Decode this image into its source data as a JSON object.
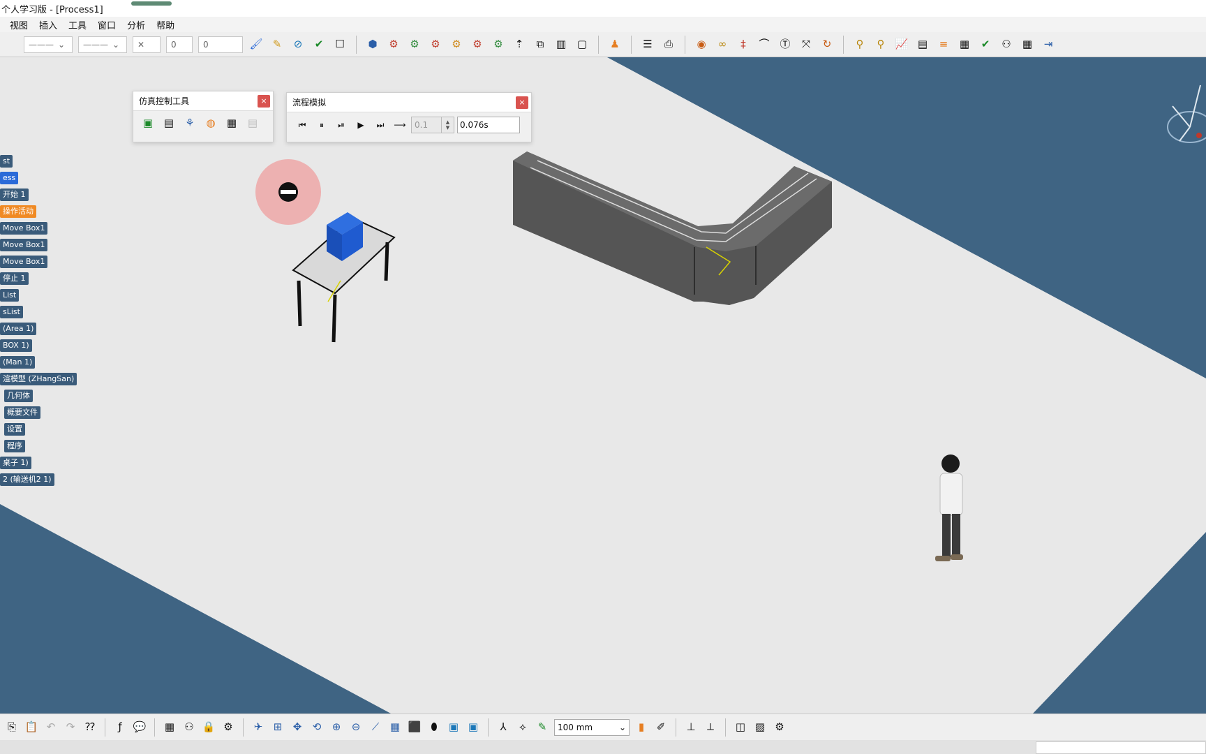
{
  "window": {
    "title": "个人学习版  - [Process1]"
  },
  "menu": {
    "items": [
      "视图",
      "插入",
      "工具",
      "窗口",
      "分析",
      "帮助"
    ]
  },
  "top_toolbar": {
    "line_combo_1": "———",
    "line_combo_2": "———",
    "weight_combo": "✕",
    "layer_combo": "0",
    "value_field": "0"
  },
  "sim_control_panel": {
    "title": "仿真控制工具",
    "close": "×"
  },
  "process_sim_panel": {
    "title": "流程模拟",
    "close": "×",
    "step_value": "0.1",
    "time_value": "0.076s"
  },
  "tree": {
    "items": [
      "st",
      "ess",
      "开始 1",
      "操作活动",
      "Move Box1",
      "Move Box1",
      "Move Box1",
      "停止 1",
      "List",
      "sList",
      "(Area 1)",
      "BOX 1)",
      "(Man 1)",
      "渲模型 (ZHangSan)",
      "几何体",
      "概要文件",
      "设置",
      "程序",
      "桌子 1)",
      "2 (输送机2 1)"
    ]
  },
  "bottom_toolbar": {
    "zoom_value": "100 mm"
  },
  "colors": {
    "floor": "#e8e8e8",
    "background_blue": "#3f6483",
    "tree_node": "#3a5b7a",
    "tree_highlight": "#f08a24",
    "box_blue": "#1f5bd0",
    "conveyor": "#555555"
  },
  "icons": {
    "top": [
      "brush-icon",
      "pen-icon",
      "compass-icon",
      "check-icon",
      "checkbox-icon",
      "catalog-icon",
      "robot-icon",
      "gear-icon",
      "gear-icon",
      "gear-icon",
      "gear-icon",
      "gear-icon",
      "arrow-icon",
      "select-icon",
      "bar-icon",
      "frame-icon",
      "person-icon",
      "align-icon",
      "camera-icon",
      "sim-icon",
      "link-icon",
      "track-icon",
      "arc-icon",
      "text-icon",
      "fit-icon",
      "refresh-icon",
      "zoom-icon",
      "zoom-icon",
      "chart-icon",
      "database-icon",
      "stack-icon",
      "book-icon",
      "check-icon",
      "network-icon",
      "book-icon",
      "export-icon"
    ],
    "bottom": [
      "copy-icon",
      "paste-icon",
      "undo-icon",
      "redo-icon",
      "help-icon",
      "formula-icon",
      "comment-icon",
      "table-icon",
      "tree-icon",
      "lock-icon",
      "sim-icon",
      "fly-icon",
      "fit-all-icon",
      "pan-icon",
      "rotate-icon",
      "zoom-in-icon",
      "zoom-out-icon",
      "normal-view-icon",
      "grid-view-icon",
      "cube-icon",
      "cylinder-icon",
      "image-icon",
      "image-icon",
      "axes-icon",
      "snap-icon",
      "edit-icon",
      "color-icon",
      "measure-icon",
      "measure-icon",
      "material-icon",
      "render-icon",
      "gear-icon"
    ]
  }
}
